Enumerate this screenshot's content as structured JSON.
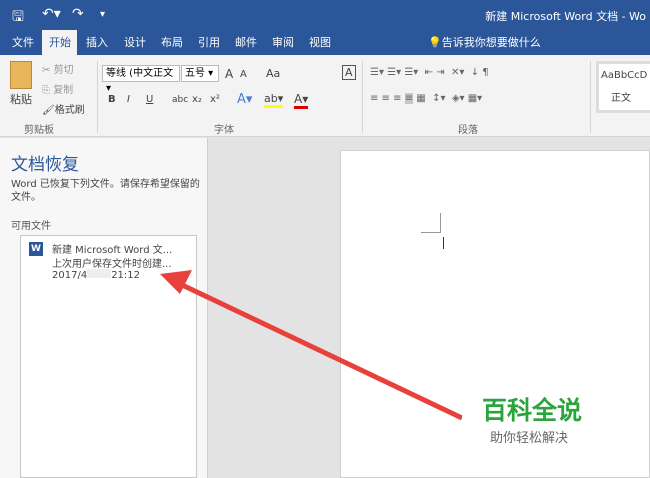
{
  "title_bar": {
    "title": "新建 Microsoft Word 文档 - Wo",
    "save_icon": "save-icon",
    "undo_icon": "undo-icon",
    "redo_icon": "redo-icon"
  },
  "tabs": [
    {
      "label": "文件"
    },
    {
      "label": "开始"
    },
    {
      "label": "插入"
    },
    {
      "label": "设计"
    },
    {
      "label": "布局"
    },
    {
      "label": "引用"
    },
    {
      "label": "邮件"
    },
    {
      "label": "审阅"
    },
    {
      "label": "视图"
    }
  ],
  "tell_me": "告诉我你想要做什么",
  "clipboard": {
    "paste": "粘贴",
    "cut": "剪切",
    "copy": "复制",
    "format_painter": "格式刷",
    "group": "剪贴板"
  },
  "font": {
    "name": "等线 (中文正文",
    "size": "五号",
    "group": "字体",
    "bold": "B",
    "italic": "I",
    "underline": "U",
    "strike": "abc",
    "sub": "x₂",
    "sup": "x²",
    "grow": "A",
    "shrink": "A",
    "case": "Aa"
  },
  "paragraph": {
    "group": "段落"
  },
  "styles": {
    "preview": "AaBbCcD",
    "normal": "正文"
  },
  "recovery": {
    "title": "文档恢复",
    "desc": "Word 已恢复下列文件。请保存希望保留的文件。",
    "available": "可用文件",
    "files": [
      {
        "name": "新建 Microsoft Word 文...",
        "note": "上次用户保存文件时创建...",
        "time_prefix": "2017/4",
        "time_suffix": "21:12"
      }
    ]
  },
  "watermark": {
    "title": "百科全说",
    "subtitle": "助你轻松解决"
  },
  "colors": {
    "brand": "#2b579a",
    "arrow": "#e8403a",
    "watermark": "#2aa53c"
  }
}
